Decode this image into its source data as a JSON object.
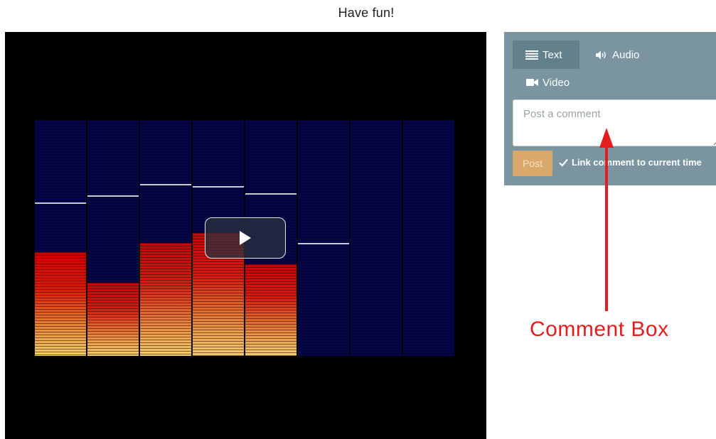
{
  "page": {
    "title": "Have fun!"
  },
  "video": {
    "visualizer_bars": [
      {
        "level": 0.44,
        "peak": 0.65
      },
      {
        "level": 0.31,
        "peak": 0.68
      },
      {
        "level": 0.48,
        "peak": 0.73
      },
      {
        "level": 0.52,
        "peak": 0.72
      },
      {
        "level": 0.39,
        "peak": 0.69
      },
      {
        "level": 0.0,
        "peak": 0.48
      },
      {
        "level": 0.0,
        "peak": null
      },
      {
        "level": 0.0,
        "peak": null
      }
    ],
    "play_icon": "play-icon"
  },
  "comment_panel": {
    "tabs": [
      {
        "label": "Text",
        "icon": "list-icon",
        "active": true
      },
      {
        "label": "Audio",
        "icon": "speaker-icon",
        "active": false
      },
      {
        "label": "Video",
        "icon": "video-camera-icon",
        "active": false
      }
    ],
    "input_placeholder": "Post a comment",
    "post_label": "Post",
    "link_time_label": "Link comment to current time",
    "link_time_checked": true
  },
  "annotation": {
    "label": "Comment Box",
    "color": "#e41e1e"
  },
  "colors": {
    "panel_bg": "#7a959f",
    "active_tab_bg": "#62808b",
    "post_button_bg": "#d9a86a",
    "visualizer_bg": "#05054b"
  }
}
